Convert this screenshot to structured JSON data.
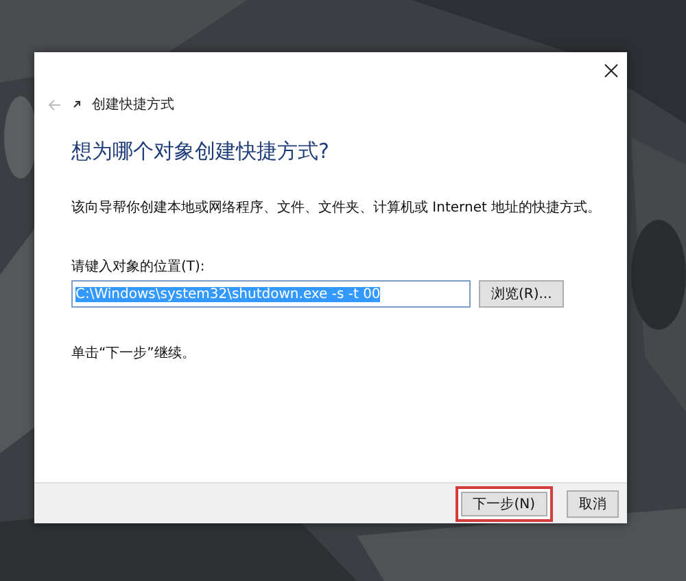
{
  "dialog": {
    "title": "创建快捷方式",
    "heading": "想为哪个对象创建快捷方式?",
    "description": "该向导帮你创建本地或网络程序、文件、文件夹、计算机或 Internet 地址的快捷方式。",
    "location_label": "请键入对象的位置(T):",
    "location_value": "C:\\Windows\\system32\\shutdown.exe -s -t 00",
    "value_selected": true,
    "hint": "单击“下一步”继续。"
  },
  "buttons": [
    {
      "kind": "browse",
      "label": "浏览(R)...",
      "highlighted": false
    },
    {
      "kind": "footer",
      "label": "下一步(N)",
      "highlighted": true
    },
    {
      "kind": "footer",
      "label": "取消",
      "highlighted": false
    }
  ]
}
